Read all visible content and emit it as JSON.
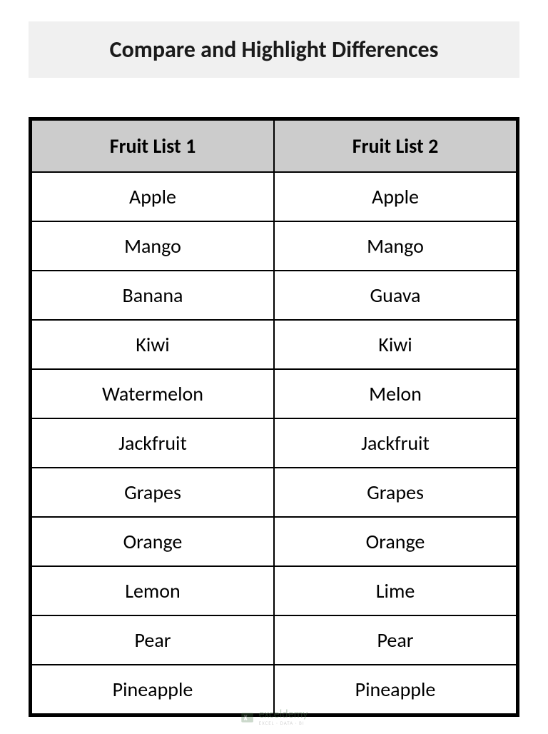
{
  "title": "Compare and Highlight Differences",
  "table": {
    "headers": [
      "Fruit List 1",
      "Fruit List 2"
    ],
    "rows": [
      [
        "Apple",
        "Apple"
      ],
      [
        "Mango",
        "Mango"
      ],
      [
        "Banana",
        "Guava"
      ],
      [
        "Kiwi",
        "Kiwi"
      ],
      [
        "Watermelon",
        "Melon"
      ],
      [
        "Jackfruit",
        "Jackfruit"
      ],
      [
        "Grapes",
        "Grapes"
      ],
      [
        "Orange",
        "Orange"
      ],
      [
        "Lemon",
        "Lime"
      ],
      [
        "Pear",
        "Pear"
      ],
      [
        "Pineapple",
        "Pineapple"
      ]
    ]
  },
  "watermark": {
    "brand": "exceldemy",
    "tagline": "EXCEL · DATA · BI"
  }
}
